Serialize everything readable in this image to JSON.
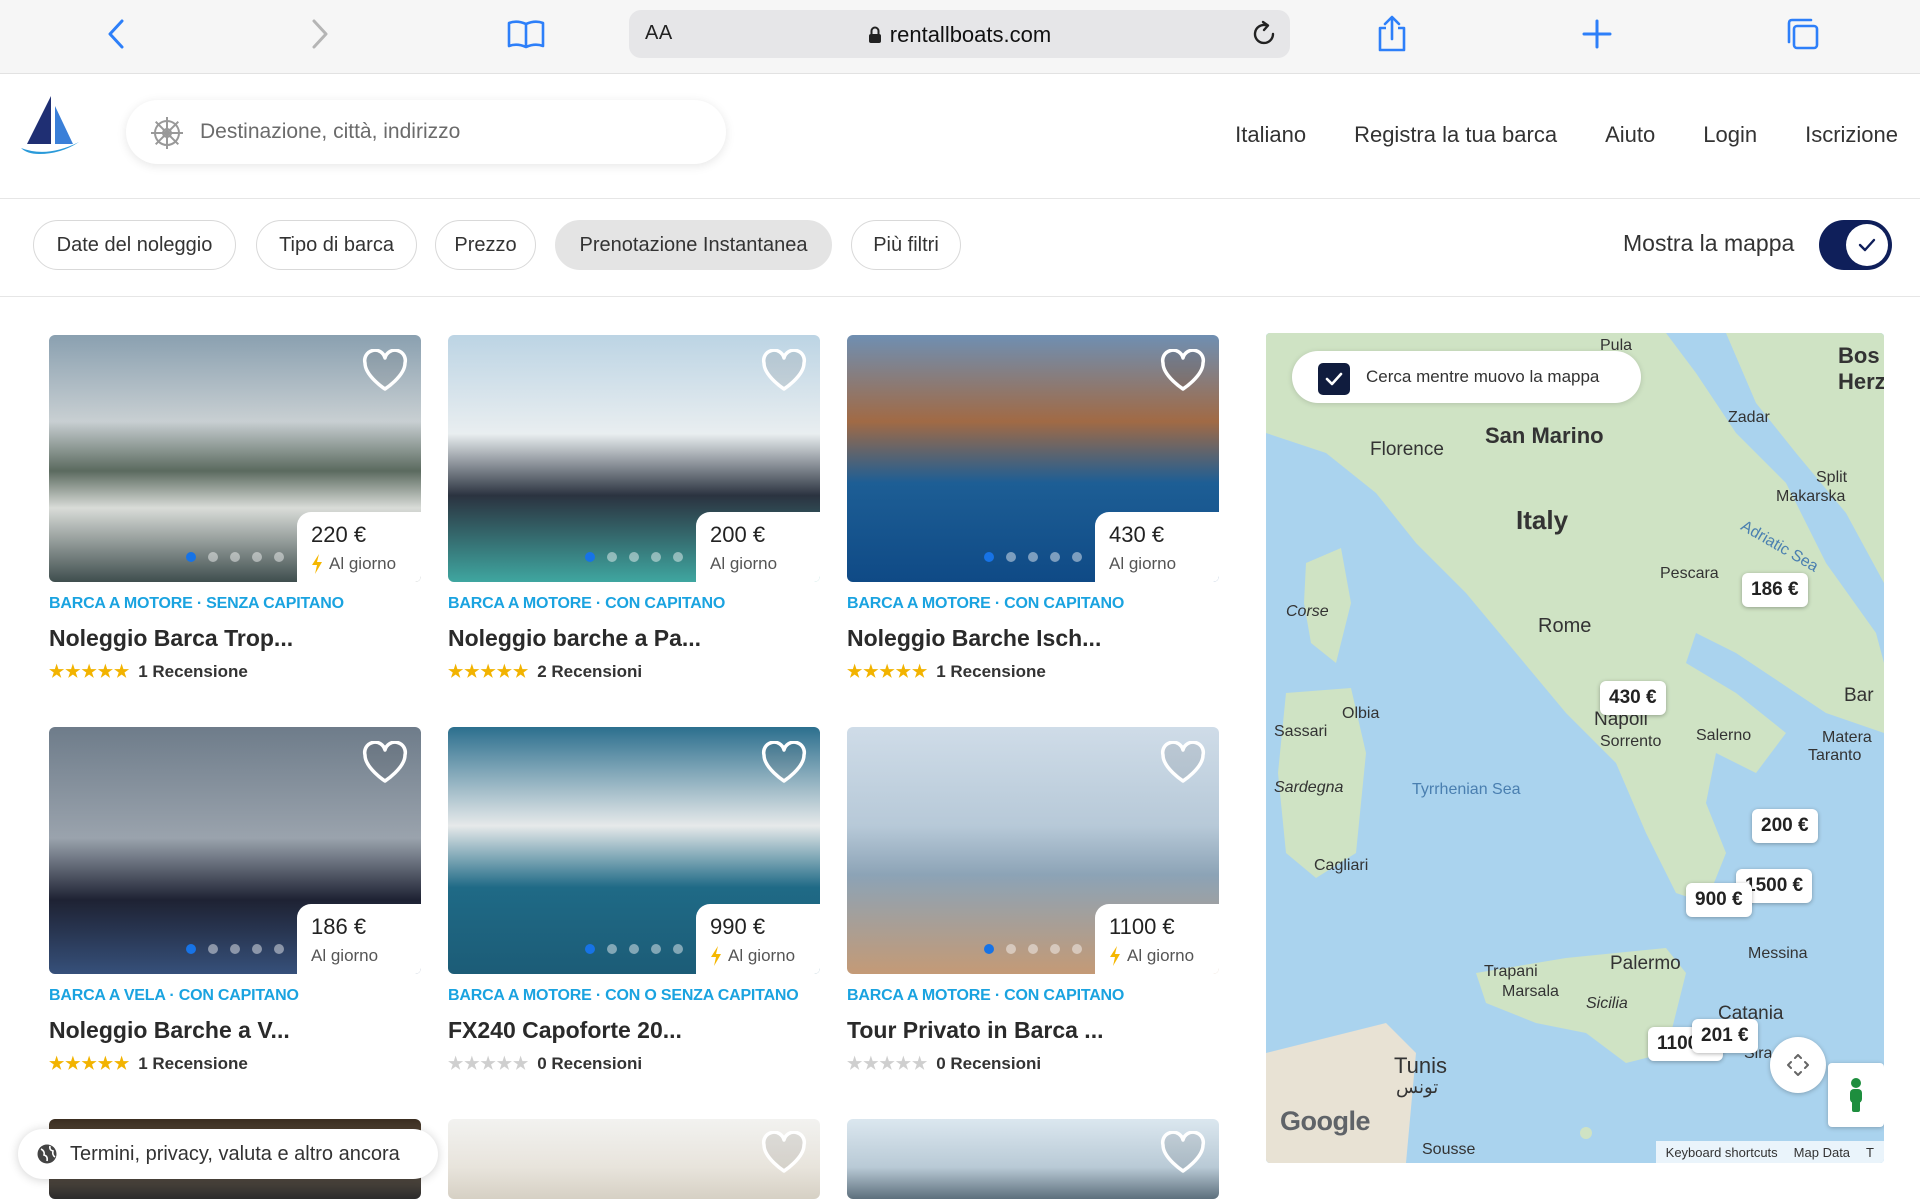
{
  "browser": {
    "text_size_label": "AA",
    "url": "rentallboats.com"
  },
  "header": {
    "search_placeholder": "Destinazione, città, indirizzo",
    "nav": [
      "Italiano",
      "Registra la tua barca",
      "Aiuto",
      "Login",
      "Iscrizione"
    ]
  },
  "filters": {
    "chips": [
      "Date del noleggio",
      "Tipo di barca",
      "Prezzo",
      "Prenotazione Instantanea",
      "Più filtri"
    ],
    "active_chip": "Prenotazione Instantanea",
    "map_toggle_label": "Mostra la mappa",
    "map_toggle_on": true
  },
  "listings": [
    {
      "price": "220 €",
      "per_day": "Al giorno",
      "instant": true,
      "type": "BARCA A MOTORE · SENZA CAPITANO",
      "title": "Noleggio Barca Trop...",
      "rating": 5,
      "reviews": "1 Recensione"
    },
    {
      "price": "200 €",
      "per_day": "Al giorno",
      "instant": false,
      "type": "BARCA A MOTORE · CON CAPITANO",
      "title": "Noleggio barche a Pa...",
      "rating": 5,
      "reviews": "2 Recensioni"
    },
    {
      "price": "430 €",
      "per_day": "Al giorno",
      "instant": false,
      "type": "BARCA A MOTORE · CON CAPITANO",
      "title": "Noleggio Barche Isch...",
      "rating": 5,
      "reviews": "1 Recensione"
    },
    {
      "price": "186 €",
      "per_day": "Al giorno",
      "instant": false,
      "type": "BARCA A VELA · CON CAPITANO",
      "title": "Noleggio Barche a V...",
      "rating": 5,
      "reviews": "1 Recensione"
    },
    {
      "price": "990 €",
      "per_day": "Al giorno",
      "instant": true,
      "type": "BARCA A MOTORE · CON O SENZA CAPITANO",
      "title": "FX240 Capoforte 20...",
      "rating": 0,
      "reviews": "0 Recensioni"
    },
    {
      "price": "1100 €",
      "per_day": "Al giorno",
      "instant": true,
      "type": "BARCA A MOTORE · CON CAPITANO",
      "title": "Tour Privato in Barca ...",
      "rating": 0,
      "reviews": "0 Recensioni"
    }
  ],
  "map": {
    "search_as_move_label": "Cerca mentre muovo la mappa",
    "search_as_move_checked": true,
    "labels": [
      "Florence",
      "San Marino",
      "Italy",
      "Zadar",
      "Split",
      "Makarska",
      "Adriatic Sea",
      "Pescara",
      "Corse",
      "Rome",
      "Bos Herz",
      "Olbia",
      "Sassari",
      "Napoli",
      "Sorrento",
      "Salerno",
      "Bar",
      "Matera",
      "Taranto",
      "Sardegna",
      "Tyrrhenian Sea",
      "Cagliari",
      "Palermo",
      "Messina",
      "Trapani",
      "Marsala",
      "Sicilia",
      "Catania",
      "Siracusa",
      "Tunis",
      "تونس",
      "Sousse",
      "Pula"
    ],
    "markers": [
      "186 €",
      "430 €",
      "200 €",
      "1500 €",
      "900 €",
      "1100 €",
      "201 €"
    ],
    "google": "Google",
    "footer": [
      "Keyboard shortcuts",
      "Map Data",
      "T"
    ]
  },
  "footer_pill": "Termini, privacy, valuta e altro ancora",
  "colors": {
    "accent_blue": "#1aa3e0",
    "toggle_navy": "#0f1f5a",
    "star_gold": "#f2b300",
    "browser_blue": "#2d7ff9"
  }
}
